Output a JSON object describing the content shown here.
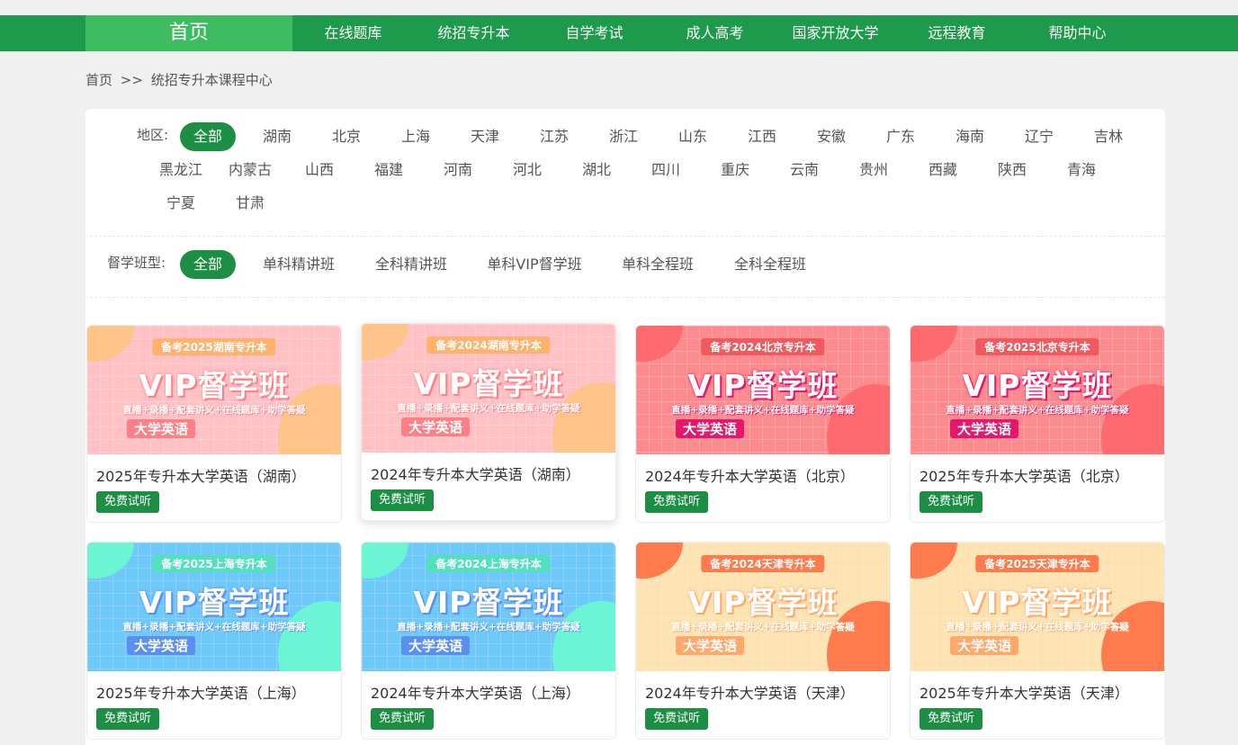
{
  "nav": {
    "home": "首页",
    "items": [
      "在线题库",
      "统招专升本",
      "自学考试",
      "成人高考",
      "国家开放大学",
      "远程教育",
      "帮助中心"
    ]
  },
  "breadcrumb": {
    "home": "首页",
    "sep": ">>",
    "current": "统招专升本课程中心"
  },
  "region": {
    "label": "地区:",
    "options": [
      "全部",
      "湖南",
      "北京",
      "上海",
      "天津",
      "江苏",
      "浙江",
      "山东",
      "江西",
      "安徽",
      "广东",
      "海南",
      "辽宁",
      "吉林",
      "黑龙江",
      "内蒙古",
      "山西",
      "福建",
      "河南",
      "河北",
      "湖北",
      "四川",
      "重庆",
      "云南",
      "贵州",
      "西藏",
      "陕西",
      "青海",
      "宁夏",
      "甘肃"
    ],
    "selected": "全部"
  },
  "classtype": {
    "label": "督学班型:",
    "options": [
      "全部",
      "单科精讲班",
      "全科精讲班",
      "单科VIP督学班",
      "单科全程班",
      "全科全程班"
    ],
    "selected": "全部"
  },
  "theme_colors": {
    "nav_green": "#1d9a4b",
    "home_green": "#3dbd5f",
    "chip_green": "#1d8f45"
  },
  "card_common": {
    "vip": "VIP督学班",
    "sub": "直播+录播+配套讲义+在线题库+助学答疑",
    "subject": "大学英语",
    "trial": "免费试听"
  },
  "courses": [
    {
      "tag": "备考2025湖南专升本",
      "title": "2025年专升本大学英语（湖南）",
      "theme": "pink"
    },
    {
      "tag": "备考2024湖南专升本",
      "title": "2024年专升本大学英语（湖南）",
      "theme": "pink"
    },
    {
      "tag": "备考2024北京专升本",
      "title": "2024年专升本大学英语（北京）",
      "theme": "red"
    },
    {
      "tag": "备考2025北京专升本",
      "title": "2025年专升本大学英语（北京）",
      "theme": "red"
    },
    {
      "tag": "备考2025上海专升本",
      "title": "2025年专升本大学英语（上海）",
      "theme": "blue"
    },
    {
      "tag": "备考2024上海专升本",
      "title": "2024年专升本大学英语（上海）",
      "theme": "blue"
    },
    {
      "tag": "备考2024天津专升本",
      "title": "2024年专升本大学英语（天津）",
      "theme": "cream"
    },
    {
      "tag": "备考2025天津专升本",
      "title": "2025年专升本大学英语（天津）",
      "theme": "cream"
    }
  ]
}
